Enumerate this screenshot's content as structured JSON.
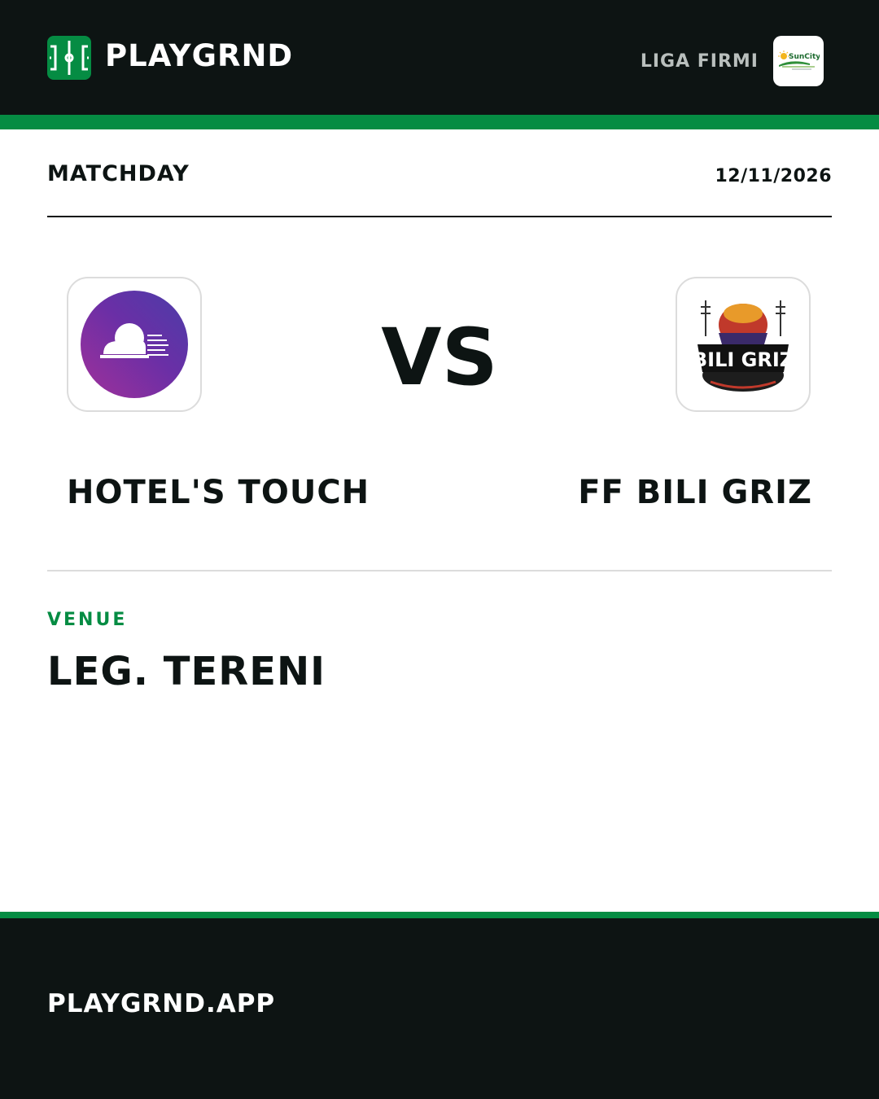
{
  "header": {
    "brand_name": "PLAYGRND",
    "brand_logo_icon": "pitch-icon",
    "league_name": "LIGA FIRMI",
    "league_badge_icon": "suncity-sponsor-logo",
    "league_badge_text": "SunCity"
  },
  "match": {
    "label": "MATCHDAY",
    "date": "12/11/2026",
    "vs_text": "VS",
    "home_team": {
      "name": "HOTEL'S TOUCH",
      "logo_icon": "hotels-touch-logo"
    },
    "away_team": {
      "name": "FF BILI GRIZ",
      "logo_icon": "bili-griz-logo",
      "logo_text": "BILI GRIZ"
    }
  },
  "venue": {
    "label": "VENUE",
    "name": "LEG. TERENI"
  },
  "footer": {
    "url": "PLAYGRND.APP"
  },
  "colors": {
    "dark": "#0d1413",
    "brand_green": "#058c43",
    "muted_text": "#b9bfbd",
    "divider": "#dcdcdc",
    "home_logo_purple": "#6a2fa6",
    "home_logo_pink": "#a0309a"
  }
}
